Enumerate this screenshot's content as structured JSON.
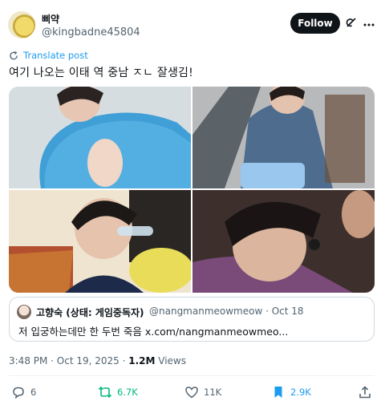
{
  "author": {
    "display_name": "삐약",
    "handle": "@kingbadne45804"
  },
  "header": {
    "follow_label": "Follow",
    "grok_icon": "grok-icon",
    "more_icon": "more-icon"
  },
  "translate": {
    "label": "Translate post",
    "icon": "translate-icon",
    "color": "#1d9bf0"
  },
  "tweet_text": "여기 나오는 이태 역 중남 ㅈㄴ 잘생김!",
  "media": {
    "photo_count": 4
  },
  "quote": {
    "display_name": "고향숙 (상태: 게임중독자)",
    "handle_time": "@nangmanmeowmeow · Oct 18",
    "text": "저 입궁하는데만 한 두번 죽음 x.com/nangmanmeowmeo..."
  },
  "meta": {
    "timestamp": "3:48 PM · Oct 19, 2025 · ",
    "views_count": "1.2M",
    "views_label": " Views"
  },
  "actions": {
    "replies": "6",
    "reposts": "6.7K",
    "likes": "11K",
    "bookmarks": "2.9K",
    "repost_color": "#00ba7c",
    "bookmark_color": "#1d9bf0"
  }
}
